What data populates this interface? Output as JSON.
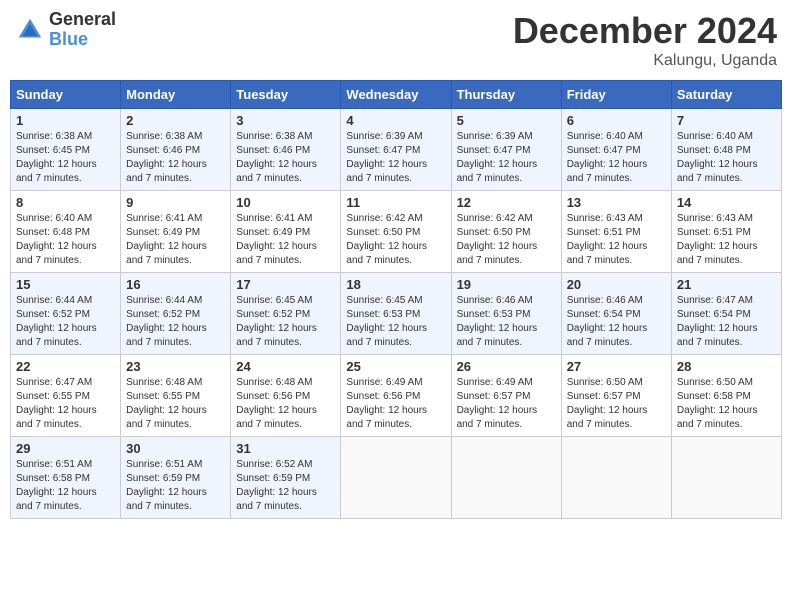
{
  "logo": {
    "general": "General",
    "blue": "Blue"
  },
  "title": {
    "month": "December 2024",
    "location": "Kalungu, Uganda"
  },
  "weekdays": [
    "Sunday",
    "Monday",
    "Tuesday",
    "Wednesday",
    "Thursday",
    "Friday",
    "Saturday"
  ],
  "weeks": [
    [
      {
        "day": "1",
        "sunrise": "6:38 AM",
        "sunset": "6:45 PM",
        "daylight": "12 hours and 7 minutes."
      },
      {
        "day": "2",
        "sunrise": "6:38 AM",
        "sunset": "6:46 PM",
        "daylight": "12 hours and 7 minutes."
      },
      {
        "day": "3",
        "sunrise": "6:38 AM",
        "sunset": "6:46 PM",
        "daylight": "12 hours and 7 minutes."
      },
      {
        "day": "4",
        "sunrise": "6:39 AM",
        "sunset": "6:47 PM",
        "daylight": "12 hours and 7 minutes."
      },
      {
        "day": "5",
        "sunrise": "6:39 AM",
        "sunset": "6:47 PM",
        "daylight": "12 hours and 7 minutes."
      },
      {
        "day": "6",
        "sunrise": "6:40 AM",
        "sunset": "6:47 PM",
        "daylight": "12 hours and 7 minutes."
      },
      {
        "day": "7",
        "sunrise": "6:40 AM",
        "sunset": "6:48 PM",
        "daylight": "12 hours and 7 minutes."
      }
    ],
    [
      {
        "day": "8",
        "sunrise": "6:40 AM",
        "sunset": "6:48 PM",
        "daylight": "12 hours and 7 minutes."
      },
      {
        "day": "9",
        "sunrise": "6:41 AM",
        "sunset": "6:49 PM",
        "daylight": "12 hours and 7 minutes."
      },
      {
        "day": "10",
        "sunrise": "6:41 AM",
        "sunset": "6:49 PM",
        "daylight": "12 hours and 7 minutes."
      },
      {
        "day": "11",
        "sunrise": "6:42 AM",
        "sunset": "6:50 PM",
        "daylight": "12 hours and 7 minutes."
      },
      {
        "day": "12",
        "sunrise": "6:42 AM",
        "sunset": "6:50 PM",
        "daylight": "12 hours and 7 minutes."
      },
      {
        "day": "13",
        "sunrise": "6:43 AM",
        "sunset": "6:51 PM",
        "daylight": "12 hours and 7 minutes."
      },
      {
        "day": "14",
        "sunrise": "6:43 AM",
        "sunset": "6:51 PM",
        "daylight": "12 hours and 7 minutes."
      }
    ],
    [
      {
        "day": "15",
        "sunrise": "6:44 AM",
        "sunset": "6:52 PM",
        "daylight": "12 hours and 7 minutes."
      },
      {
        "day": "16",
        "sunrise": "6:44 AM",
        "sunset": "6:52 PM",
        "daylight": "12 hours and 7 minutes."
      },
      {
        "day": "17",
        "sunrise": "6:45 AM",
        "sunset": "6:52 PM",
        "daylight": "12 hours and 7 minutes."
      },
      {
        "day": "18",
        "sunrise": "6:45 AM",
        "sunset": "6:53 PM",
        "daylight": "12 hours and 7 minutes."
      },
      {
        "day": "19",
        "sunrise": "6:46 AM",
        "sunset": "6:53 PM",
        "daylight": "12 hours and 7 minutes."
      },
      {
        "day": "20",
        "sunrise": "6:46 AM",
        "sunset": "6:54 PM",
        "daylight": "12 hours and 7 minutes."
      },
      {
        "day": "21",
        "sunrise": "6:47 AM",
        "sunset": "6:54 PM",
        "daylight": "12 hours and 7 minutes."
      }
    ],
    [
      {
        "day": "22",
        "sunrise": "6:47 AM",
        "sunset": "6:55 PM",
        "daylight": "12 hours and 7 minutes."
      },
      {
        "day": "23",
        "sunrise": "6:48 AM",
        "sunset": "6:55 PM",
        "daylight": "12 hours and 7 minutes."
      },
      {
        "day": "24",
        "sunrise": "6:48 AM",
        "sunset": "6:56 PM",
        "daylight": "12 hours and 7 minutes."
      },
      {
        "day": "25",
        "sunrise": "6:49 AM",
        "sunset": "6:56 PM",
        "daylight": "12 hours and 7 minutes."
      },
      {
        "day": "26",
        "sunrise": "6:49 AM",
        "sunset": "6:57 PM",
        "daylight": "12 hours and 7 minutes."
      },
      {
        "day": "27",
        "sunrise": "6:50 AM",
        "sunset": "6:57 PM",
        "daylight": "12 hours and 7 minutes."
      },
      {
        "day": "28",
        "sunrise": "6:50 AM",
        "sunset": "6:58 PM",
        "daylight": "12 hours and 7 minutes."
      }
    ],
    [
      {
        "day": "29",
        "sunrise": "6:51 AM",
        "sunset": "6:58 PM",
        "daylight": "12 hours and 7 minutes."
      },
      {
        "day": "30",
        "sunrise": "6:51 AM",
        "sunset": "6:59 PM",
        "daylight": "12 hours and 7 minutes."
      },
      {
        "day": "31",
        "sunrise": "6:52 AM",
        "sunset": "6:59 PM",
        "daylight": "12 hours and 7 minutes."
      },
      null,
      null,
      null,
      null
    ]
  ],
  "labels": {
    "sunrise": "Sunrise:",
    "sunset": "Sunset:",
    "daylight": "Daylight:"
  }
}
